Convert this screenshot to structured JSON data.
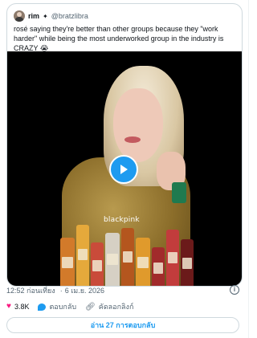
{
  "quote": {
    "display_name": "rim",
    "badge": "✦",
    "handle": "@bratzlibra",
    "text": "rosé saying they're better than other groups because they \"work harder\" while being the most underworked group in the industry is CRAZY 😭",
    "video_watermark": "blackpink"
  },
  "meta": {
    "time": "12:52 ก่อนเที่ยง",
    "separator": "·",
    "date": "6 เม.ย. 2026"
  },
  "actions": {
    "likes": "3.8K",
    "reply_label": "ตอบกลับ",
    "copy_link_label": "คัดลอกลิงก์"
  },
  "read_replies_label": "อ่าน 27 การตอบกลับ",
  "colors": {
    "accent": "#1d9bf0",
    "like": "#f91880",
    "muted": "#536471",
    "border": "#cfd9de"
  },
  "icons": {
    "play": "play-icon",
    "info": "info-icon",
    "heart": "heart-icon",
    "reply": "reply-icon",
    "link": "link-icon"
  }
}
